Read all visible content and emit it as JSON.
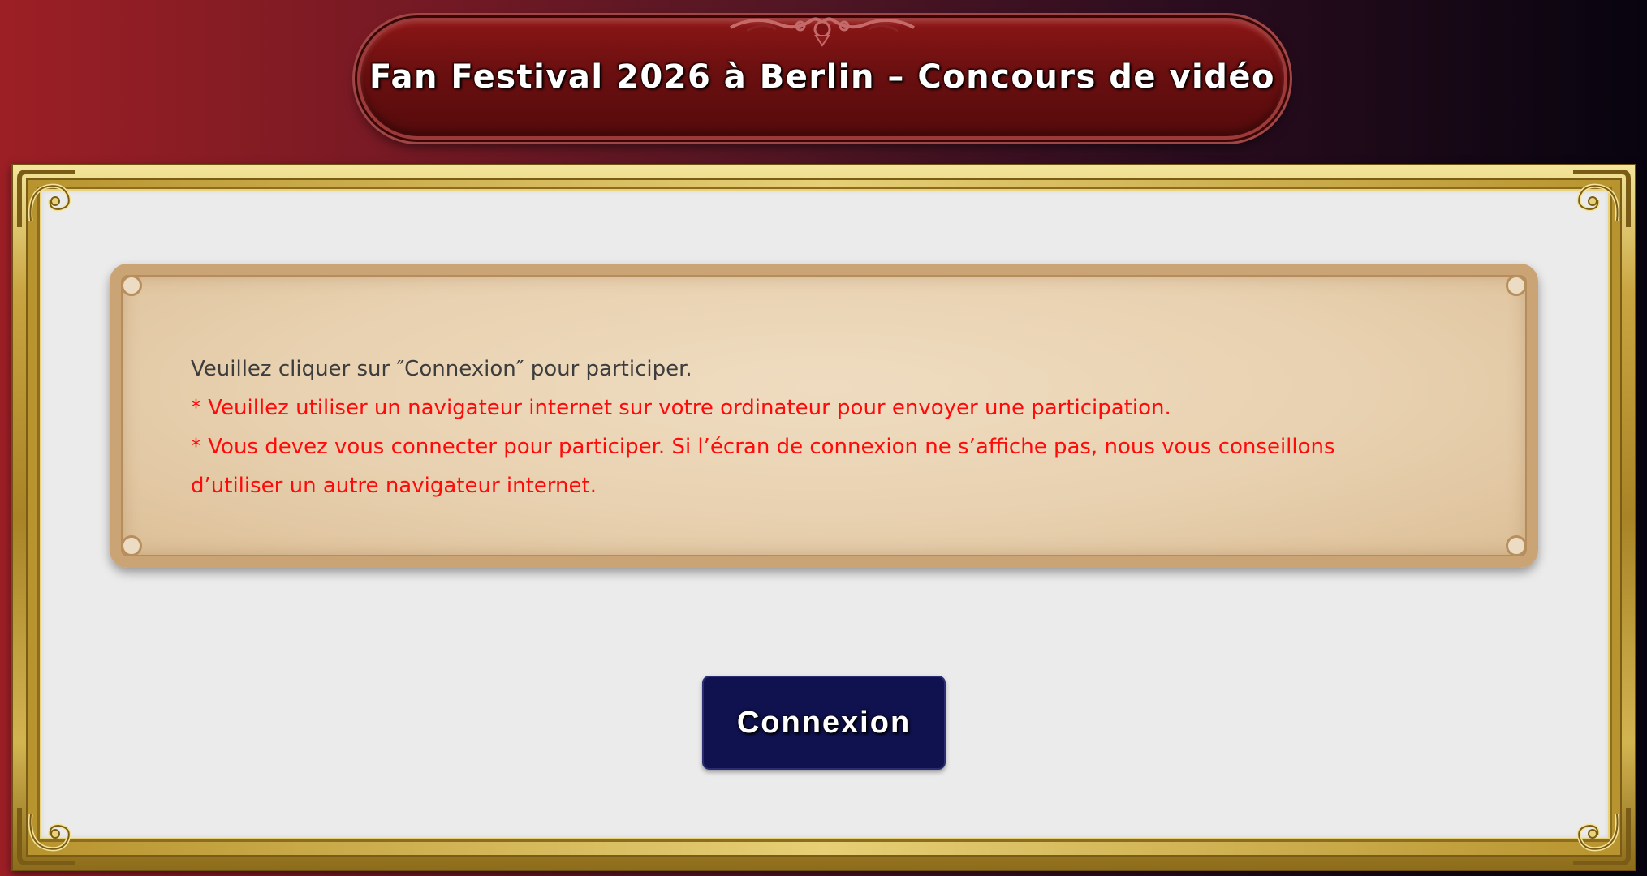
{
  "header": {
    "title": "Fan Festival 2026 à Berlin – Concours de vidéo"
  },
  "notice": {
    "line1": "Veuillez cliquer sur ″Connexion″ pour participer.",
    "line2": "* Veuillez utiliser un navigateur internet sur votre ordinateur pour envoyer une participation.",
    "line3": "* Vous devez vous connecter pour participer. Si l’écran de connexion ne s’affiche pas, nous vous conseillons",
    "line4": "d’utiliser un autre navigateur internet."
  },
  "actions": {
    "login_label": "Connexion"
  },
  "colors": {
    "notice_text": "#3d3d3d",
    "warning_text": "#ff0a0a",
    "button_bg": "#10124f",
    "banner_bg": "#6a0f10",
    "frame_gold": "#c9a541"
  }
}
